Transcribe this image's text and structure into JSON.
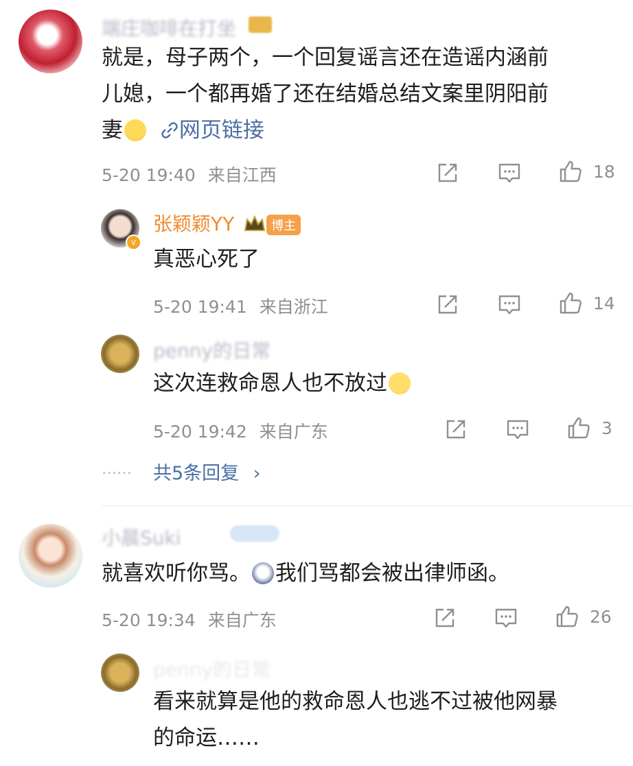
{
  "comments": [
    {
      "user": "端庄咖啡在打坐",
      "text_lines": [
        "就是，母子两个，一个回复谣言还在造谣内涵前",
        "儿媳，一个都再婚了还在结婚总结文案里阴阳前",
        "妻"
      ],
      "link_label": "网页链接",
      "time": "5-20 19:40",
      "location": "来自江西",
      "likes": "18"
    },
    {
      "user": "张颖颖YY",
      "badge": "博主",
      "text": "真恶心死了",
      "time": "5-20 19:41",
      "location": "来自浙江",
      "likes": "14"
    },
    {
      "user": "penny的日常",
      "text": "这次连救命恩人也不放过",
      "time": "5-20 19:42",
      "location": "来自广东",
      "likes": "3"
    },
    {
      "user": "小晨Suki",
      "text_a": "就喜欢听你骂。",
      "text_b": "我们骂都会被出律师函。",
      "time": "5-20 19:34",
      "location": "来自广东",
      "likes": "26"
    },
    {
      "user": "penny的日常",
      "text_lines": [
        "看来就算是他的救命恩人也逃不过被他网暴",
        "的命运……"
      ]
    }
  ],
  "replies": {
    "dots": "……",
    "more_label": "共5条回复",
    "chevron": "›"
  },
  "icons": {
    "share": "share-icon",
    "comment": "comment-icon",
    "like": "thumbs-up-icon",
    "link": "link-icon",
    "crown": "crown-icon"
  }
}
